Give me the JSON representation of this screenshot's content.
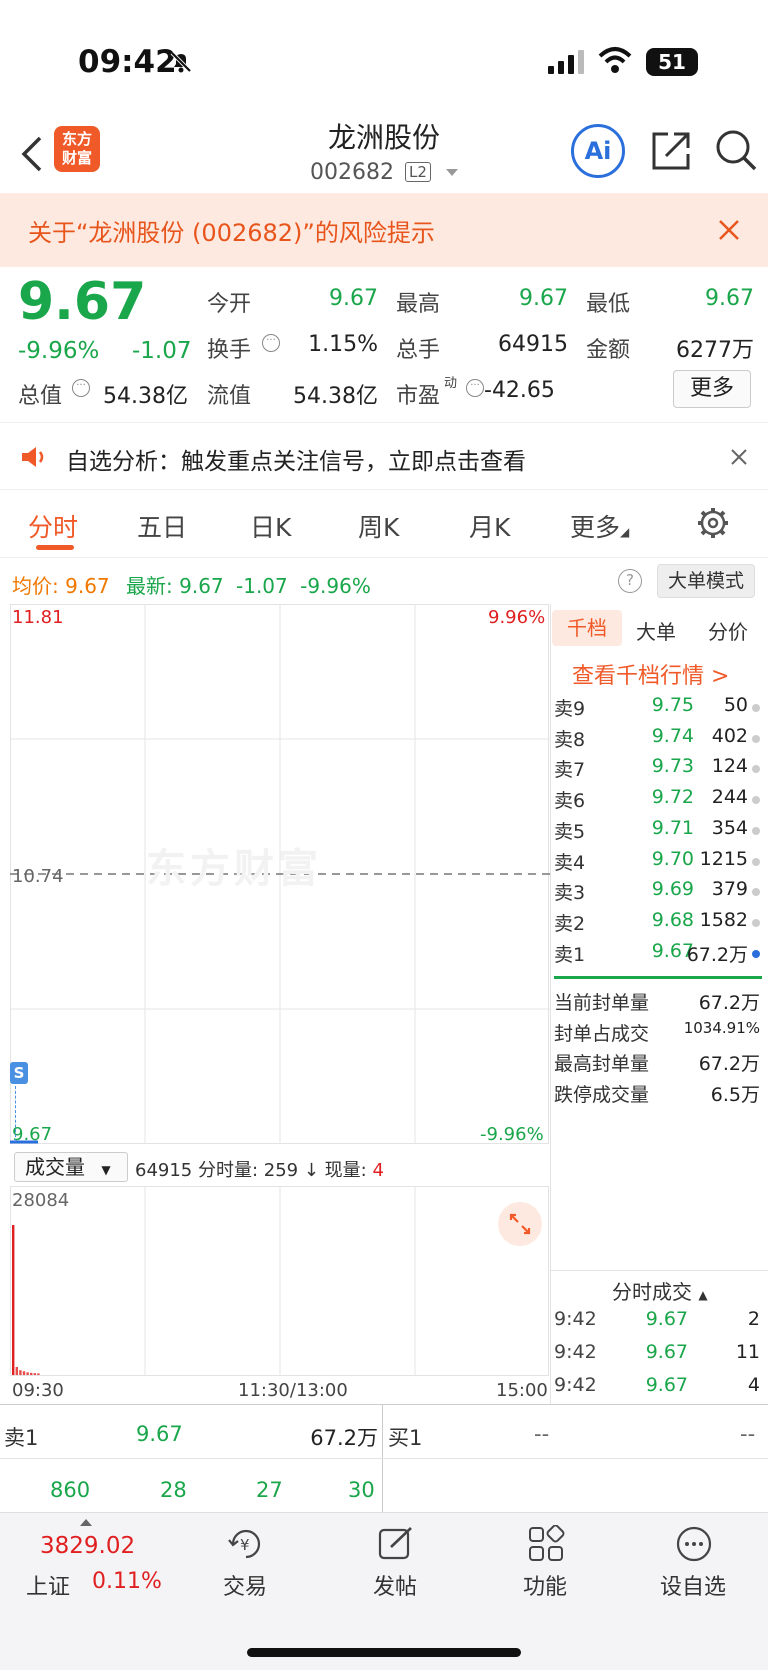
{
  "status_bar": {
    "time": "09:42",
    "battery": "51"
  },
  "header": {
    "title": "龙洲股份",
    "code": "002682",
    "level": "L2",
    "logo_top": "东方",
    "logo_bottom": "财富",
    "ai_label": "Ai"
  },
  "risk_banner": {
    "text": "关于“龙洲股份 (002682)”的风险提示"
  },
  "quote": {
    "price": "9.67",
    "pct": "-9.96%",
    "chg": "-1.07",
    "open_label": "今开",
    "open": "9.67",
    "high_label": "最高",
    "high": "9.67",
    "low_label": "最低",
    "low": "9.67",
    "turnover_label": "换手",
    "turnover": "1.15%",
    "volume_label": "总手",
    "volume": "64915",
    "amount_label": "金额",
    "amount": "6277万",
    "mktcap_label": "总值",
    "mktcap": "54.38亿",
    "float_label": "流值",
    "float": "54.38亿",
    "pe_label": "市盈",
    "pe_sup": "动",
    "pe": "-42.65",
    "more_button": "更多"
  },
  "alert": {
    "text": "自选分析：触发重点关注信号，立即点击查看"
  },
  "tabs": [
    {
      "label": "分时",
      "active": true
    },
    {
      "label": "五日"
    },
    {
      "label": "日K"
    },
    {
      "label": "周K"
    },
    {
      "label": "月K"
    },
    {
      "label": "更多"
    }
  ],
  "info_line": {
    "avg_label": "均价:",
    "avg": "9.67",
    "latest_label": "最新:",
    "latest": "9.67",
    "latest_chg": "-1.07",
    "latest_pct": "-9.96%",
    "mode_button": "大单模式"
  },
  "chart": {
    "y_max": "11.81",
    "y_mid": "10.74",
    "y_min": "9.67",
    "pct_max": "9.96%",
    "pct_min": "-9.96%",
    "watermark": "东方财富",
    "marker": "S",
    "x_labels": [
      "09:30",
      "11:30/13:00",
      "15:00"
    ],
    "vol_selector": "成交量",
    "vol_info": "64915 分时量: 259 ↓ 现量: ",
    "vol_now": "4",
    "vol_max": "28084"
  },
  "chart_data": {
    "type": "line",
    "price_series": [
      {
        "time": "09:30",
        "price": 9.67
      }
    ],
    "ylim": [
      9.67,
      11.81
    ],
    "reference_price": 10.74,
    "x_ticks": [
      "09:30",
      "11:30/13:00",
      "15:00"
    ],
    "volume_max": 28084,
    "volume_bars": [
      28084,
      1500,
      900,
      700,
      500,
      400,
      350,
      300
    ]
  },
  "orderbook": {
    "tabs": [
      "千档",
      "大单",
      "分价"
    ],
    "link": "查看千档行情 >",
    "asks": [
      {
        "label": "卖9",
        "price": "9.75",
        "vol": "50"
      },
      {
        "label": "卖8",
        "price": "9.74",
        "vol": "402"
      },
      {
        "label": "卖7",
        "price": "9.73",
        "vol": "124"
      },
      {
        "label": "卖6",
        "price": "9.72",
        "vol": "244"
      },
      {
        "label": "卖5",
        "price": "9.71",
        "vol": "354"
      },
      {
        "label": "卖4",
        "price": "9.70",
        "vol": "1215"
      },
      {
        "label": "卖3",
        "price": "9.69",
        "vol": "379"
      },
      {
        "label": "卖2",
        "price": "9.68",
        "vol": "1582"
      },
      {
        "label": "卖1",
        "price": "9.67",
        "vol": "67.2万"
      }
    ],
    "stats": [
      {
        "label": "当前封单量",
        "value": "67.2万"
      },
      {
        "label": "封单占成交",
        "value": "1034.91%"
      },
      {
        "label": "最高封单量",
        "value": "67.2万"
      },
      {
        "label": "跌停成交量",
        "value": "6.5万"
      }
    ],
    "trades_title": "分时成交",
    "trades": [
      {
        "time": "9:42",
        "price": "9.67",
        "vol": "2"
      },
      {
        "time": "9:42",
        "price": "9.67",
        "vol": "11"
      },
      {
        "time": "9:42",
        "price": "9.67",
        "vol": "4"
      }
    ]
  },
  "bottom_quote": {
    "ask_label": "卖1",
    "ask_price": "9.67",
    "ask_vol": "67.2万",
    "bid_label": "买1",
    "bid_price": "--",
    "bid_vol": "--",
    "nums": [
      "860",
      "28",
      "27",
      "30"
    ]
  },
  "bottom_nav": {
    "index_value": "3829.02",
    "index_name": "上证",
    "index_pct": "0.11%",
    "items": [
      "交易",
      "发帖",
      "功能",
      "设自选"
    ]
  }
}
